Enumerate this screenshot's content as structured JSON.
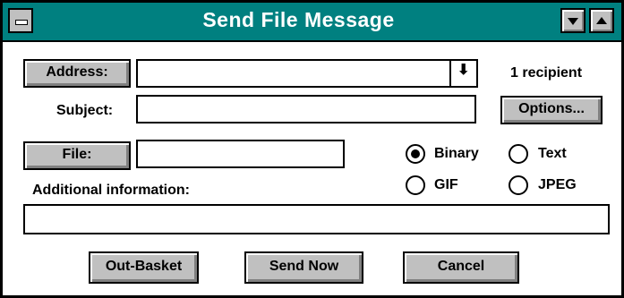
{
  "window": {
    "title": "Send File Message"
  },
  "address": {
    "button_label": "Address:",
    "value": "",
    "recipient_count": "1 recipient"
  },
  "subject": {
    "label": "Subject:",
    "value": ""
  },
  "options_button": "Options...",
  "file": {
    "button_label": "File:",
    "value": ""
  },
  "format": {
    "options": [
      {
        "label": "Binary",
        "selected": true
      },
      {
        "label": "Text",
        "selected": false
      },
      {
        "label": "GIF",
        "selected": false
      },
      {
        "label": "JPEG",
        "selected": false
      }
    ]
  },
  "additional_info": {
    "label": "Additional information:",
    "value": ""
  },
  "actions": {
    "out_basket": "Out-Basket",
    "send_now": "Send Now",
    "cancel": "Cancel"
  }
}
